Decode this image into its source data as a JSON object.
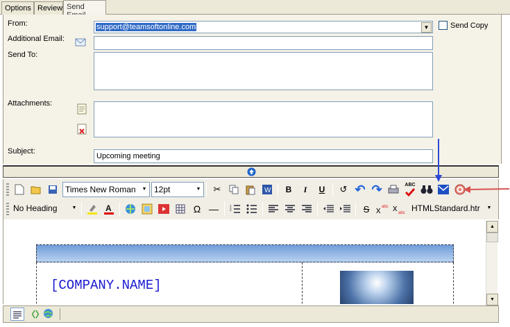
{
  "tabs": [
    {
      "label": "Options"
    },
    {
      "label": "Review"
    },
    {
      "label": "Send Email",
      "active": true
    }
  ],
  "form": {
    "from_label": "From:",
    "from_value": "support@teamsoftonline.com",
    "send_copy_label": "Send Copy",
    "additional_email_label": "Additional Email:",
    "send_to_label": "Send To:",
    "attachments_label": "Attachments:",
    "subject_label": "Subject:",
    "subject_value": "Upcoming meeting"
  },
  "toolbar": {
    "font_name": "Times New Roman",
    "font_size": "12pt",
    "heading": "No Heading",
    "template": "HTMLStandard.htr",
    "spell_label": "ABC"
  },
  "editor": {
    "company_name": "[COMPANY.NAME]"
  },
  "colors": {
    "accent_arrow_blue": "#2b48d6",
    "accent_arrow_red": "#d9534f",
    "selection": "#316ac5"
  }
}
